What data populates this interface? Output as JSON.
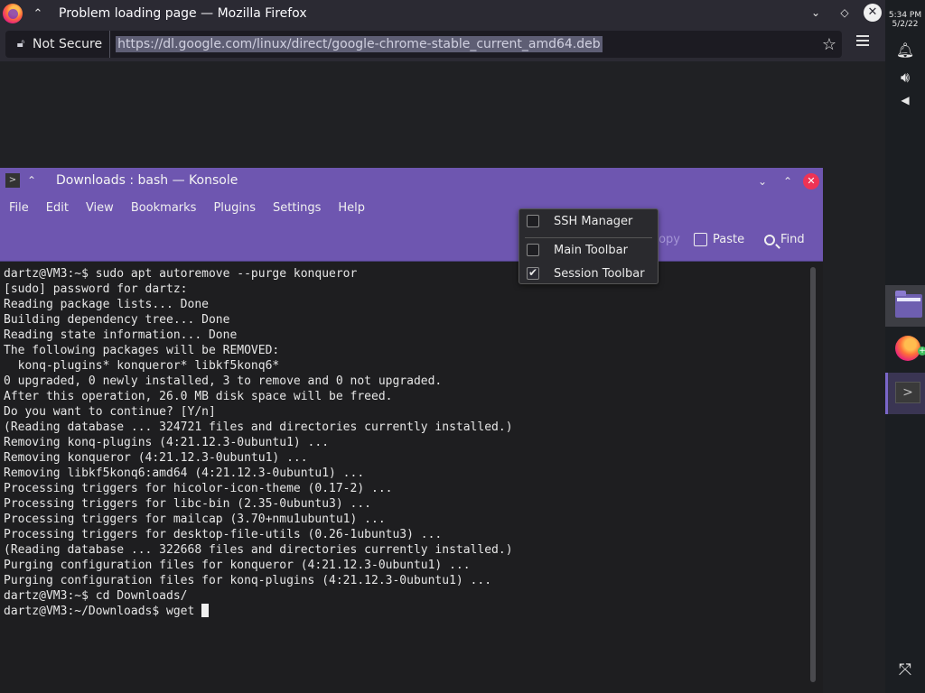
{
  "firefox": {
    "title": "Problem loading page — Mozilla Firefox",
    "security_label": "Not Secure",
    "url": "https://dl.google.com/linux/direct/google-chrome-stable_current_amd64.deb"
  },
  "panel": {
    "time": "5:34 PM",
    "date": "5/2/22"
  },
  "konsole": {
    "title": "Downloads : bash — Konsole",
    "menu": [
      "File",
      "Edit",
      "View",
      "Bookmarks",
      "Plugins",
      "Settings",
      "Help"
    ],
    "toolbar": {
      "copy_label": "Copy",
      "paste_label": "Paste",
      "find_label": "Find"
    },
    "terminal_lines": [
      "dartz@VM3:~$ sudo apt autoremove --purge konqueror",
      "[sudo] password for dartz:",
      "Reading package lists... Done",
      "Building dependency tree... Done",
      "Reading state information... Done",
      "The following packages will be REMOVED:",
      "  konq-plugins* konqueror* libkf5konq6*",
      "0 upgraded, 0 newly installed, 3 to remove and 0 not upgraded.",
      "After this operation, 26.0 MB disk space will be freed.",
      "Do you want to continue? [Y/n]",
      "(Reading database ... 324721 files and directories currently installed.)",
      "Removing konq-plugins (4:21.12.3-0ubuntu1) ...",
      "Removing konqueror (4:21.12.3-0ubuntu1) ...",
      "Removing libkf5konq6:amd64 (4:21.12.3-0ubuntu1) ...",
      "Processing triggers for hicolor-icon-theme (0.17-2) ...",
      "Processing triggers for libc-bin (2.35-0ubuntu3) ...",
      "Processing triggers for mailcap (3.70+nmu1ubuntu1) ...",
      "Processing triggers for desktop-file-utils (0.26-1ubuntu3) ...",
      "(Reading database ... 322668 files and directories currently installed.)",
      "Purging configuration files for konqueror (4:21.12.3-0ubuntu1) ...",
      "Purging configuration files for konq-plugins (4:21.12.3-0ubuntu1) ...",
      "dartz@VM3:~$ cd Downloads/"
    ],
    "prompt_line": "dartz@VM3:~/Downloads$ wget "
  },
  "popup": {
    "items": [
      {
        "label": "SSH Manager",
        "checked": false
      },
      {
        "label": "Main Toolbar",
        "checked": false
      },
      {
        "label": "Session Toolbar",
        "checked": true
      }
    ]
  }
}
